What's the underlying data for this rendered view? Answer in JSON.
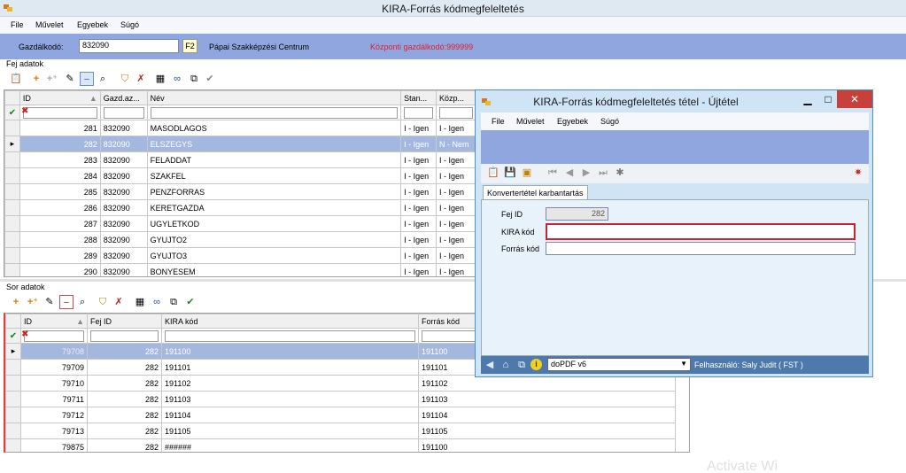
{
  "window": {
    "title": "KIRA-Forrás kódmegfeleltetés"
  },
  "menu": [
    "File",
    "Művelet",
    "Egyebek",
    "Súgó"
  ],
  "gazdalkodo": {
    "label": "Gazdálkodó:",
    "code": "832090",
    "f2": "F2",
    "name": "Pápai Szakképzési Centrum",
    "central": "Központi gazdálkodó:999999"
  },
  "fej": {
    "label": "Fej adatok",
    "columns": [
      "ID",
      "Gazd.az...",
      "Név",
      "Stan...",
      "Közp..."
    ],
    "rows": [
      {
        "id": "281",
        "gazd": "832090",
        "nev": "MASODLAGOS",
        "stan": "I - Igen",
        "kozp": "I - Igen"
      },
      {
        "id": "282",
        "gazd": "832090",
        "nev": "ELSZEGYS",
        "stan": "I - Igen",
        "kozp": "N - Nem"
      },
      {
        "id": "283",
        "gazd": "832090",
        "nev": "FELADDAT",
        "stan": "I - Igen",
        "kozp": "I - Igen"
      },
      {
        "id": "284",
        "gazd": "832090",
        "nev": "SZAKFEL",
        "stan": "I - Igen",
        "kozp": "I - Igen"
      },
      {
        "id": "285",
        "gazd": "832090",
        "nev": "PENZFORRAS",
        "stan": "I - Igen",
        "kozp": "I - Igen"
      },
      {
        "id": "286",
        "gazd": "832090",
        "nev": "KERETGAZDA",
        "stan": "I - Igen",
        "kozp": "I - Igen"
      },
      {
        "id": "287",
        "gazd": "832090",
        "nev": "UGYLETKOD",
        "stan": "I - Igen",
        "kozp": "I - Igen"
      },
      {
        "id": "288",
        "gazd": "832090",
        "nev": "GYUJTO2",
        "stan": "I - Igen",
        "kozp": "I - Igen"
      },
      {
        "id": "289",
        "gazd": "832090",
        "nev": "GYUJTO3",
        "stan": "I - Igen",
        "kozp": "I - Igen"
      },
      {
        "id": "290",
        "gazd": "832090",
        "nev": "BONYESEM",
        "stan": "I - Igen",
        "kozp": "I - Igen"
      }
    ]
  },
  "sor": {
    "label": "Sor adatok",
    "columns": [
      "ID",
      "Fej ID",
      "KIRA kód",
      "Forrás kód"
    ],
    "rows": [
      {
        "id": "79708",
        "fej": "282",
        "kira": "191100",
        "forras": "191100"
      },
      {
        "id": "79709",
        "fej": "282",
        "kira": "191101",
        "forras": "191101"
      },
      {
        "id": "79710",
        "fej": "282",
        "kira": "191102",
        "forras": "191102"
      },
      {
        "id": "79711",
        "fej": "282",
        "kira": "191103",
        "forras": "191103"
      },
      {
        "id": "79712",
        "fej": "282",
        "kira": "191104",
        "forras": "191104"
      },
      {
        "id": "79713",
        "fej": "282",
        "kira": "191105",
        "forras": "191105"
      },
      {
        "id": "79875",
        "fej": "282",
        "kira": "######",
        "forras": "191100"
      }
    ]
  },
  "dialog": {
    "title": "KIRA-Forrás kódmegfeleltetés tétel  - Újtétel",
    "menu": [
      "File",
      "Művelet",
      "Egyebek",
      "Súgó"
    ],
    "tab": "Konvertertétel karbantartás",
    "fields": {
      "fej_id_label": "Fej ID",
      "fej_id_value": "282",
      "kira_label": "KIRA kód",
      "kira_value": "",
      "forras_label": "Forrás kód",
      "forras_value": ""
    },
    "printer": "doPDF v6",
    "user": "Felhasználó: Saly Judit ( FST )"
  },
  "watermark": "Activate Wi",
  "colors": {
    "band": "#8fa6df",
    "selected_row": "#a4b7de",
    "accent_red": "#e0202e"
  }
}
